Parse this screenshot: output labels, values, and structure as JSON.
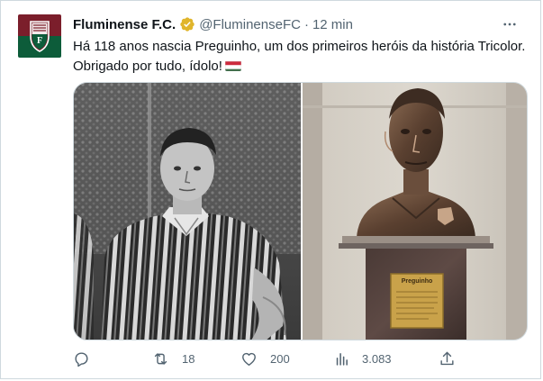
{
  "tweet": {
    "author_name": "Fluminense F.C.",
    "handle": "@FluminenseFC",
    "separator": "·",
    "time": "12 min",
    "text_line1": "Há 118 anos nascia Preguinho, um dos primeiros heróis da história Tricolor.",
    "text_line2": "Obrigado por tudo, ídolo!",
    "emoji": "flag-hungary-like-tricolor"
  },
  "media": {
    "left_image": "black-and-white photo of a footballer in striped shirt",
    "right_image": "bronze bust on marble pedestal",
    "plaque_text": "Preguinho"
  },
  "actions": {
    "reply_count": "",
    "retweet_count": "18",
    "like_count": "200",
    "views_count": "3.083"
  },
  "colors": {
    "text": "#0f1419",
    "secondary": "#536471",
    "verified": "#e0b52b",
    "border": "#cfd9de",
    "club_maroon": "#7b1e2b",
    "club_green": "#0d5c3a"
  }
}
